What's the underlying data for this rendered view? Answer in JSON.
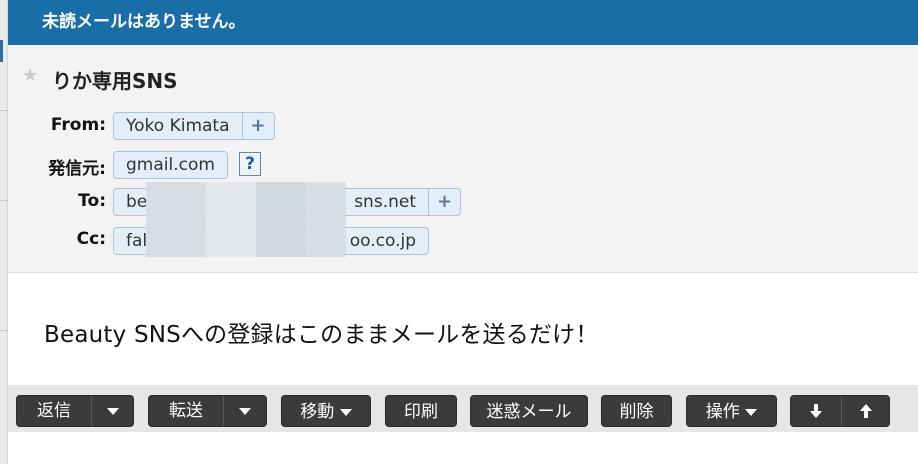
{
  "banner": {
    "text": "未読メールはありません。"
  },
  "message": {
    "subject": "りか専用SNS",
    "from": {
      "label": "From:",
      "value": "Yoko Kimata"
    },
    "sender_domain": {
      "label": "発信元:",
      "value": "gmail.com",
      "help": "?"
    },
    "to": {
      "label": "To:",
      "value_start": "be",
      "value_end": "sns.net"
    },
    "cc": {
      "label": "Cc:",
      "value_start": "fal",
      "value_end": "oo.co.jp"
    },
    "body": "Beauty SNSへの登録はこのままメールを送るだけ！"
  },
  "toolbar": {
    "reply": "返信",
    "forward": "転送",
    "move": "移動",
    "print": "印刷",
    "spam": "迷惑メール",
    "delete": "削除",
    "actions": "操作"
  },
  "colors": {
    "banner": "#1a6ea8",
    "button": "#3b3b3b",
    "chip": "#e4eef8"
  }
}
